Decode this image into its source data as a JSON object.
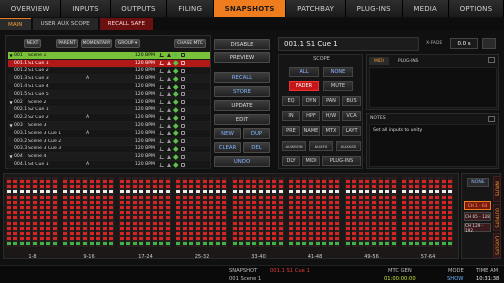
{
  "nav": {
    "tabs": [
      "OVERVIEW",
      "INPUTS",
      "OUTPUTS",
      "FILING",
      "SNAPSHOTS",
      "PATCHBAY",
      "PLUG-INS",
      "MEDIA",
      "OPTIONS"
    ],
    "active": "SNAPSHOTS"
  },
  "subtabs": {
    "main": "MAIN",
    "aux": "USER AUX SCOPE",
    "recall_safe": "RECALL SAFE"
  },
  "list_toolbar": {
    "next": "NEXT",
    "parent": "PARENT",
    "momentary": "MOMENTARY",
    "group": "GROUP ▾",
    "chase": "CHASE MTC"
  },
  "snapshots": [
    {
      "num": "001",
      "name": "Scene 1",
      "flag": "",
      "bpm": "120 BPM",
      "state": "selected",
      "tri": "▼"
    },
    {
      "num": "001.1",
      "name": "S1 Cue 1",
      "flag": "",
      "bpm": "120 BPM",
      "state": "current",
      "tri": ""
    },
    {
      "num": "001.2",
      "name": "S1 Cue 2",
      "flag": "",
      "bpm": "120 BPM",
      "state": "",
      "tri": ""
    },
    {
      "num": "001.3",
      "name": "S1 Cue 3",
      "flag": "A",
      "bpm": "120 BPM",
      "state": "",
      "tri": ""
    },
    {
      "num": "001.4",
      "name": "S1 Cue 4",
      "flag": "",
      "bpm": "120 BPM",
      "state": "",
      "tri": ""
    },
    {
      "num": "001.5",
      "name": "S1 Cue 5",
      "flag": "",
      "bpm": "120 BPM",
      "state": "",
      "tri": ""
    },
    {
      "num": "002",
      "name": "Scene 2",
      "flag": "",
      "bpm": "120 BPM",
      "state": "",
      "tri": "▼"
    },
    {
      "num": "002.1",
      "name": "S2 Cue 1",
      "flag": "",
      "bpm": "120 BPM",
      "state": "",
      "tri": ""
    },
    {
      "num": "002.2",
      "name": "S2 Cue 2",
      "flag": "A",
      "bpm": "120 BPM",
      "state": "",
      "tri": ""
    },
    {
      "num": "003",
      "name": "Scene 3",
      "flag": "",
      "bpm": "120 BPM",
      "state": "",
      "tri": "▼"
    },
    {
      "num": "003.1",
      "name": "Scene 3 Cue 1",
      "flag": "A",
      "bpm": "120 BPM",
      "state": "",
      "tri": ""
    },
    {
      "num": "003.2",
      "name": "Scene 3 Cue 2",
      "flag": "",
      "bpm": "120 BPM",
      "state": "",
      "tri": ""
    },
    {
      "num": "003.3",
      "name": "Scene 3 Cue 3",
      "flag": "",
      "bpm": "120 BPM",
      "state": "",
      "tri": ""
    },
    {
      "num": "004",
      "name": "Scene 4",
      "flag": "",
      "bpm": "120 BPM",
      "state": "",
      "tri": "▼"
    },
    {
      "num": "004.1",
      "name": "S4 Cue 1",
      "flag": "A",
      "bpm": "120 BPM",
      "state": "",
      "tri": ""
    }
  ],
  "actions": {
    "disable": "DISABLE",
    "preview": "PREVIEW",
    "recall": "RECALL",
    "store": "STORE",
    "update": "UPDATE",
    "edit": "EDIT",
    "new": "NEW",
    "dup": "DUP",
    "clear": "CLEAR",
    "del": "DEL",
    "undo": "UNDO"
  },
  "cue": {
    "title": "001.1   S1 Cue 1",
    "xfade_label": "X-FADE",
    "xfade_value": "0.0 s"
  },
  "scope": {
    "header": "SCOPE",
    "all": "ALL",
    "none": "NONE",
    "fader": "FADER",
    "mute": "MUTE",
    "eq": "EQ",
    "dyn": "DYN",
    "pan": "PAN",
    "bus": "BUS",
    "in": "IN",
    "hpf": "HPF",
    "hw": "H/W",
    "vca": "VCA",
    "pre": "PRE",
    "name": "NAME",
    "mtx": "MTX",
    "layt": "LAYT",
    "auxmon": "AUXMON",
    "auxfx": "AUXFX",
    "auxass": "AUXASS",
    "dly": "DLY",
    "midi": "MIDI",
    "plugins": "PLUG-INS"
  },
  "midi_tabs": {
    "midi": "MIDI",
    "plugins": "PLUG-INS"
  },
  "notes": {
    "header": "NOTES",
    "text": "Set all inputs to unity"
  },
  "fader_groups": [
    "1-8",
    "9-16",
    "17-24",
    "25-32",
    "33-40",
    "41-48",
    "49-56",
    "57-64"
  ],
  "channel_panel": {
    "none": "NONE",
    "ranges": [
      "CH 1 - 64",
      "CH 65 - 128",
      "CH 129 - 192"
    ],
    "selected_range": "CH 1 - 64",
    "side_tabs": [
      "INPUTS",
      "OUTPUTS",
      "LAYOUTS"
    ]
  },
  "status": {
    "snapshot_label": "SNAPSHOT",
    "current": "001.1 S1 Cue 1",
    "next": "001 Scene 1",
    "mtc_label": "MTC GEN",
    "mtc_value": "01:00:00:00",
    "mode_label": "MODE",
    "mode_value": "SHOW",
    "time_label": "TIME AM",
    "time_value": "10:31:38"
  },
  "colors": {
    "accent": "#ef7d1e",
    "selected_row": "#7ac13a",
    "current_row": "#b11818",
    "fader_red": "#d42424"
  }
}
